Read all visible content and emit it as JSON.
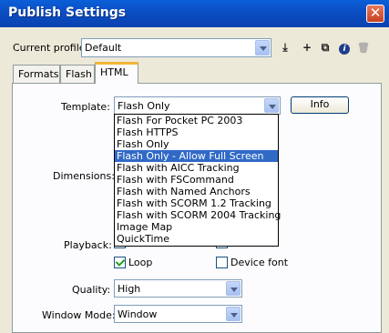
{
  "window": {
    "title": "Publish Settings",
    "close_glyph": "✕"
  },
  "profile": {
    "label": "Current profile:",
    "value": "Default",
    "tools": [
      {
        "name": "import-export-icon",
        "glyph": "⤓"
      },
      {
        "name": "add-profile-icon",
        "glyph": "+"
      },
      {
        "name": "duplicate-profile-icon",
        "glyph": "⧉"
      },
      {
        "name": "info-icon",
        "glyph": "i"
      },
      {
        "name": "delete-icon",
        "glyph": "🗑"
      }
    ]
  },
  "tabs": [
    {
      "label": "Formats"
    },
    {
      "label": "Flash"
    },
    {
      "label": "HTML",
      "active": true
    }
  ],
  "html_tab": {
    "template_label": "Template:",
    "template_value": "Flash Only",
    "info_button": "Info",
    "dimensions_label": "Dimensions:",
    "playback_label": "Playback:",
    "playback_options": [
      {
        "label": "Loop",
        "checked": true
      },
      {
        "label": "Device font",
        "checked": false
      }
    ],
    "quality_label": "Quality:",
    "quality_value": "High",
    "window_mode_label": "Window Mode:",
    "window_mode_value": "Window"
  },
  "template_options": [
    "Flash For Pocket PC 2003",
    "Flash HTTPS",
    "Flash Only",
    "Flash Only - Allow Full Screen",
    "Flash with AICC Tracking",
    "Flash with FSCommand",
    "Flash with Named Anchors",
    "Flash with SCORM 1.2 Tracking",
    "Flash with SCORM 2004 Tracking",
    "Image Map",
    "QuickTime"
  ],
  "highlighted_option_index": 3,
  "colors": {
    "title_bar": "#0b4fc4",
    "selection": "#316ac5",
    "active_tab_accent": "#f4b638"
  }
}
